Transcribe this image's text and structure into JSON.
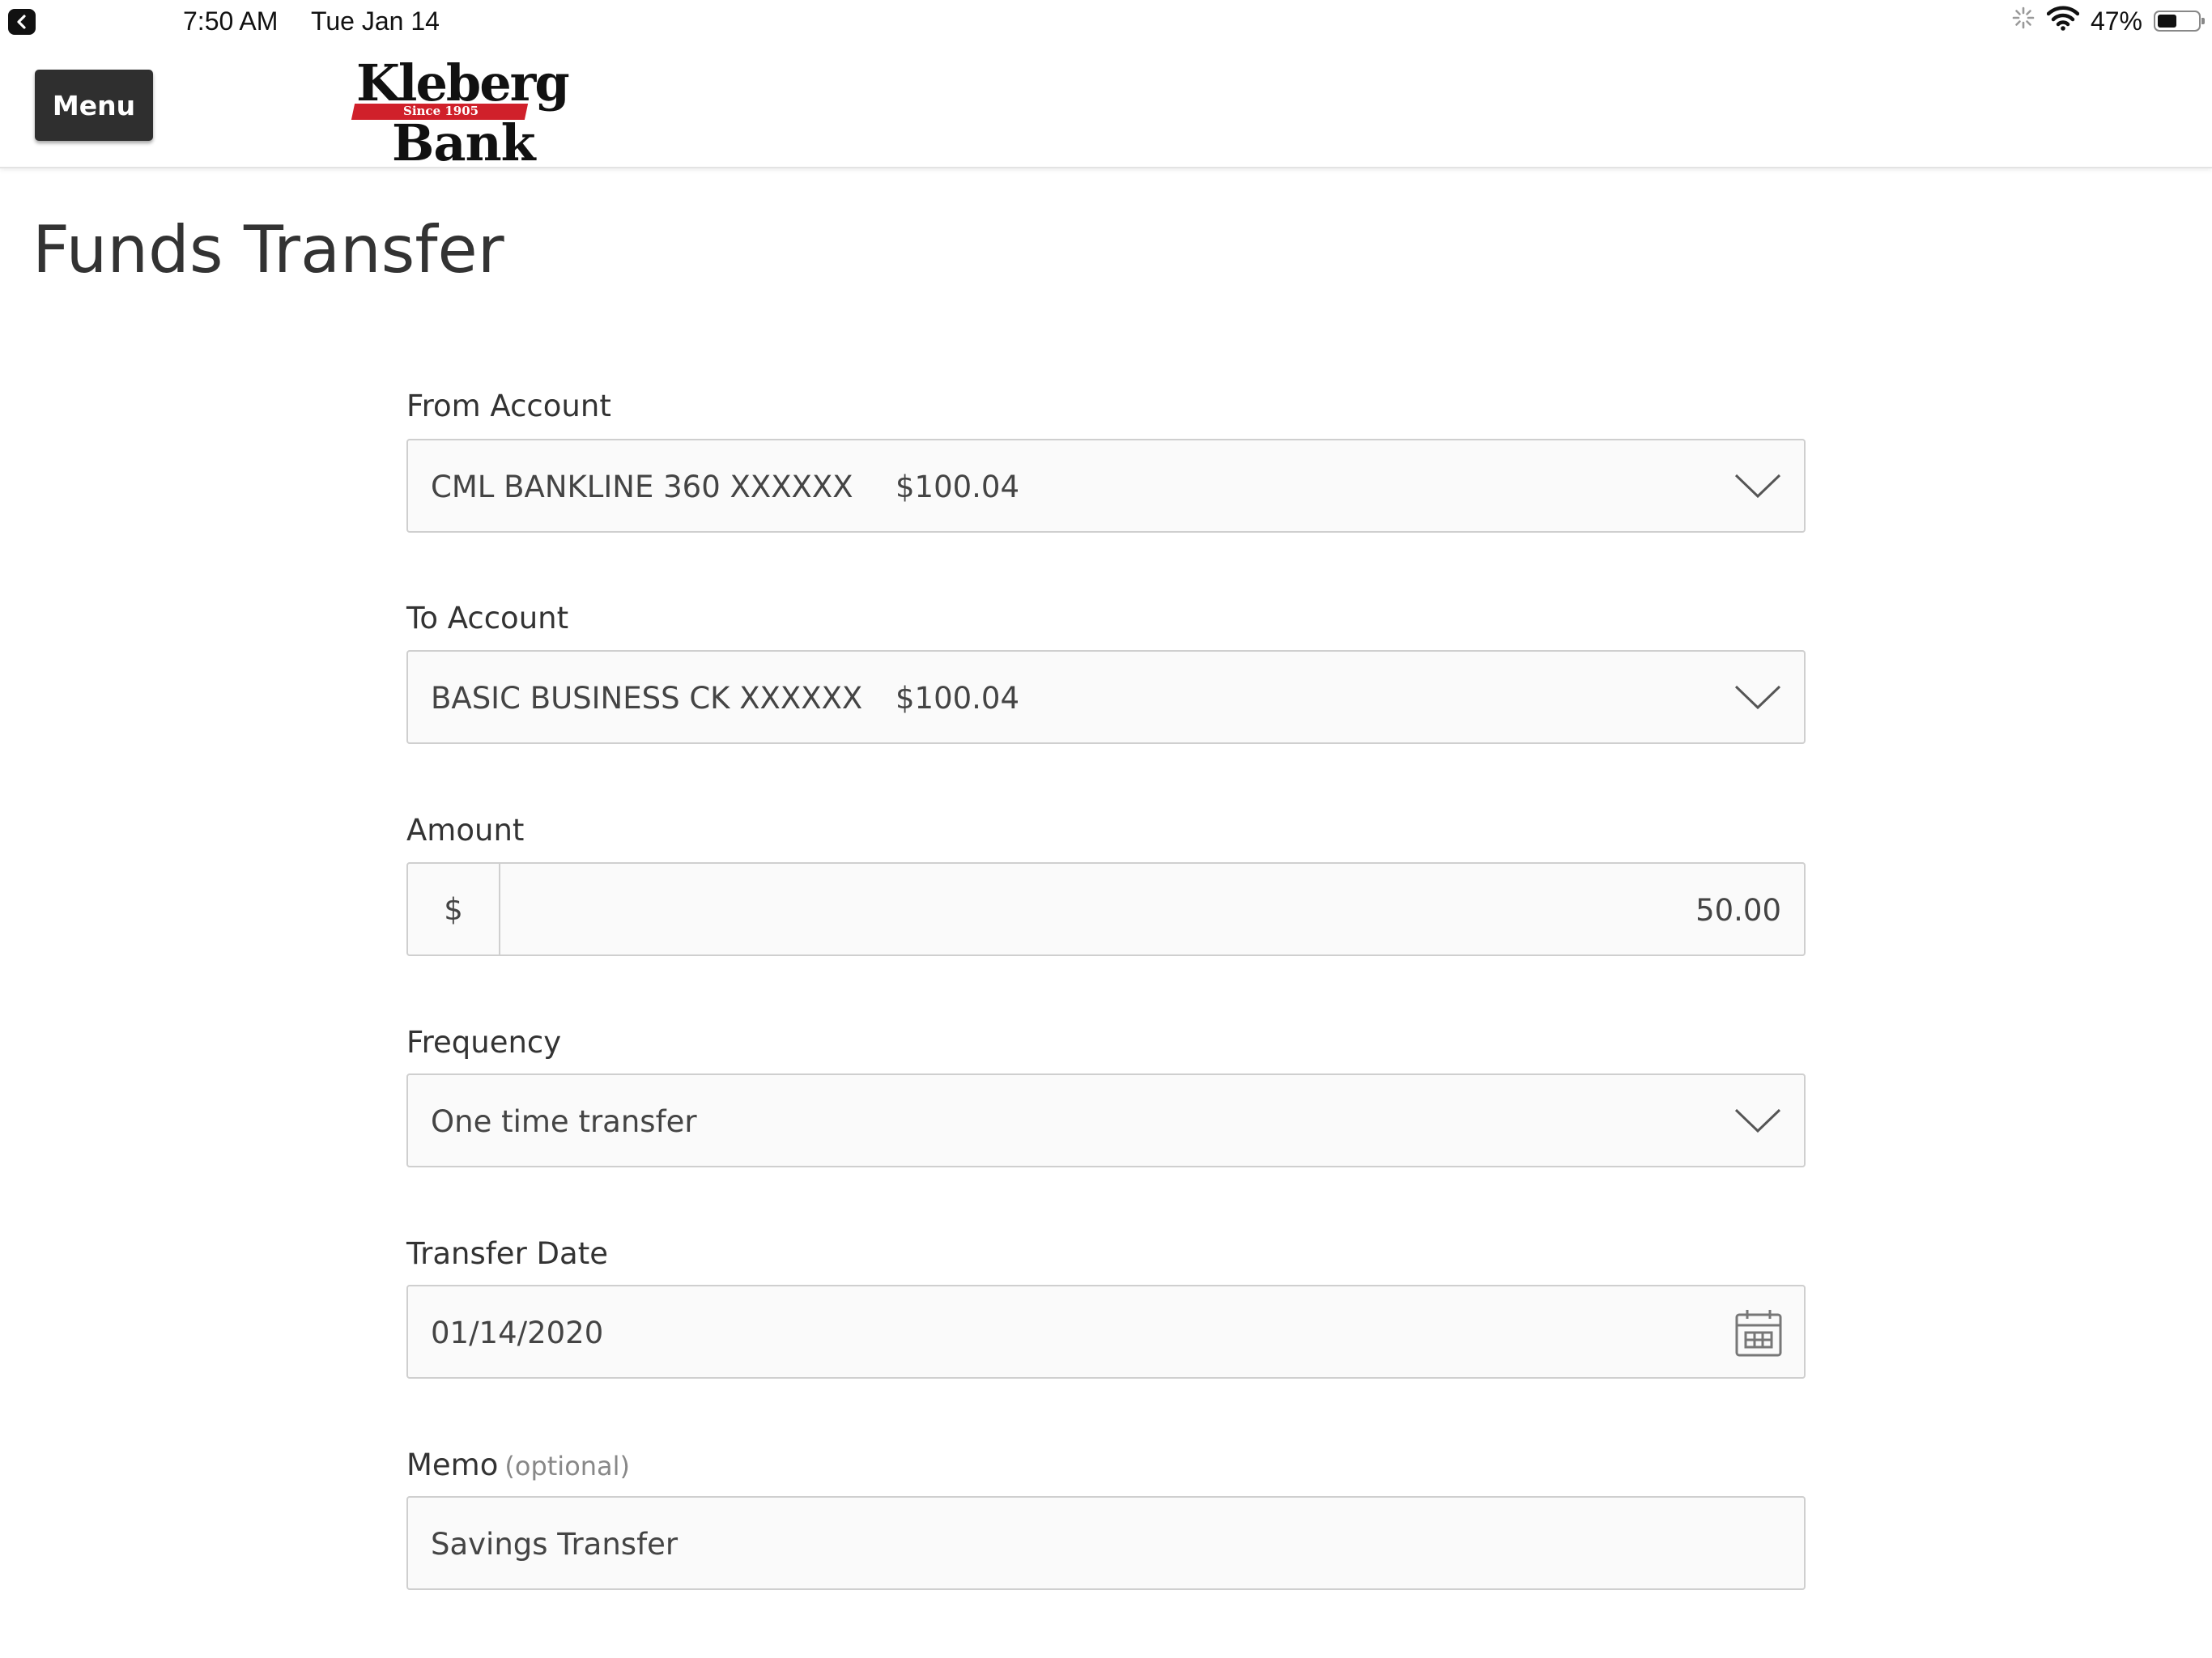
{
  "status_bar": {
    "time": "7:50 AM",
    "date": "Tue Jan 14",
    "battery": "47%",
    "battery_level": 0.47
  },
  "header": {
    "menu_label": "Menu",
    "logo": {
      "line1": "Kleberg",
      "since": "Since 1905",
      "line2": "Bank"
    }
  },
  "page_title": "Funds Transfer",
  "form": {
    "from_account": {
      "label": "From Account",
      "name": "CML BANKLINE 360 XXXXXX",
      "balance": "$100.04"
    },
    "to_account": {
      "label": "To Account",
      "name": "BASIC BUSINESS CK XXXXXX",
      "balance": "$100.04"
    },
    "amount": {
      "label": "Amount",
      "currency": "$",
      "value": "50.00"
    },
    "frequency": {
      "label": "Frequency",
      "value": "One time transfer"
    },
    "transfer_date": {
      "label": "Transfer Date",
      "value": "01/14/2020"
    },
    "memo": {
      "label": "Memo",
      "optional": "(optional)",
      "value": "Savings Transfer"
    }
  },
  "colors": {
    "menu_bg": "#2f2f2f",
    "logo_red": "#d0202a",
    "field_border": "#cfcfcf",
    "text": "#333333"
  }
}
